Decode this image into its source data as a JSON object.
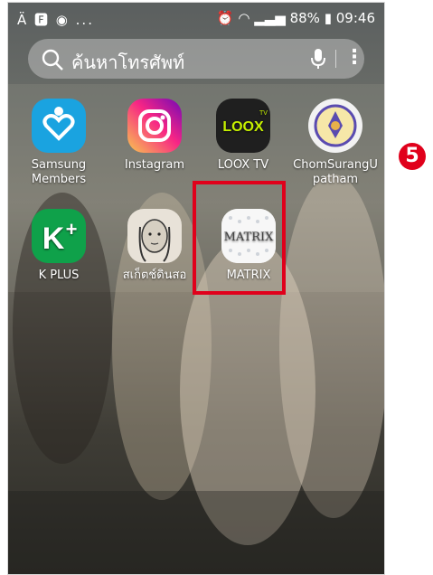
{
  "status_bar": {
    "left_icons": "Ä 🅵 ◉ ...",
    "battery": "88%",
    "time": "09:46"
  },
  "search": {
    "placeholder": "ค้นหาโทรศัพท์"
  },
  "apps": [
    {
      "label": "Samsung Members",
      "icon": "samsung-members-icon",
      "color": "#1aa3e0"
    },
    {
      "label": "Instagram",
      "icon": "instagram-icon",
      "color": "#d6249f"
    },
    {
      "label": "LOOX TV",
      "icon": "loox-tv-icon",
      "color": "#1f1f1f"
    },
    {
      "label": "ChomSurangU patham",
      "icon": "school-emblem-icon",
      "color": "#f2f2f2"
    },
    {
      "label": "K PLUS",
      "icon": "k-plus-icon",
      "color": "#0fa14a"
    },
    {
      "label": "สเก็ตช์ดินสอ",
      "icon": "pencil-sketch-icon",
      "color": "#e8e2d8"
    },
    {
      "label": "MATRIX",
      "icon": "matrix-icon",
      "color": "#ffffff"
    }
  ],
  "callout": {
    "step_number": "5"
  },
  "colors": {
    "highlight": "#e0001b"
  }
}
